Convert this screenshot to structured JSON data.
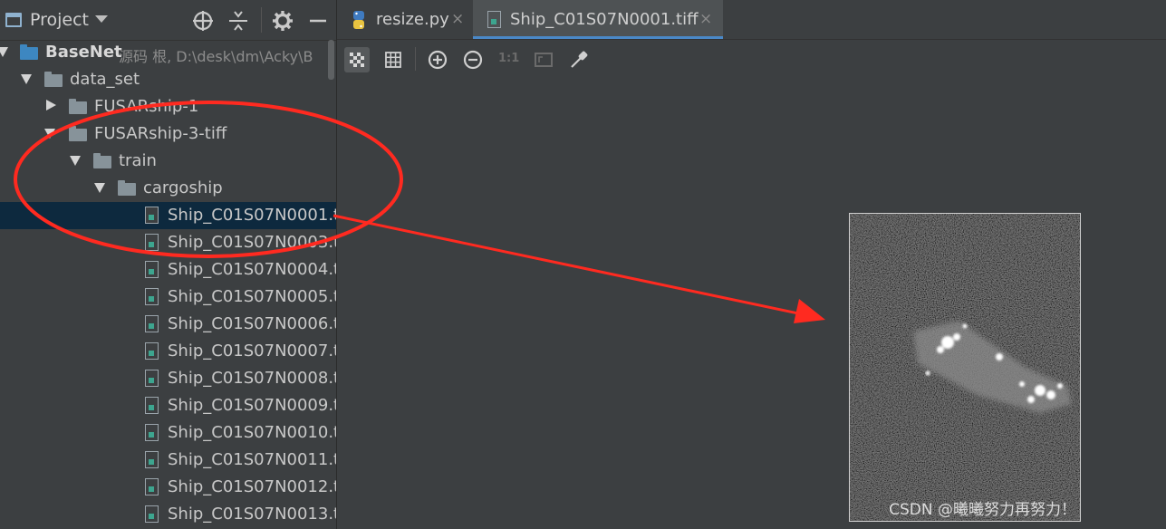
{
  "project": {
    "title": "Project",
    "icons": [
      "project-view-icon",
      "dropdown-caret-icon",
      "locate-target-icon",
      "collapse-all-icon",
      "gear-icon",
      "minimize-icon"
    ],
    "tree": [
      {
        "label": "BaseNet",
        "extra": "源码 根, D:\\desk\\dm\\Acky\\B",
        "type": "root-folder",
        "state": "expanded",
        "depth": 0
      },
      {
        "label": "data_set",
        "type": "folder",
        "state": "expanded",
        "depth": 1
      },
      {
        "label": "FUSARship-1",
        "type": "folder",
        "state": "collapsed",
        "depth": 2
      },
      {
        "label": "FUSARship-3-tiff",
        "type": "folder",
        "state": "expanded",
        "depth": 2
      },
      {
        "label": "train",
        "type": "folder",
        "state": "expanded",
        "depth": 3
      },
      {
        "label": "cargoship",
        "type": "folder",
        "state": "expanded",
        "depth": 4
      },
      {
        "label": "Ship_C01S07N0001.ti",
        "type": "file",
        "selected": true
      },
      {
        "label": "Ship_C01S07N0003.ti",
        "type": "file"
      },
      {
        "label": "Ship_C01S07N0004.ti",
        "type": "file"
      },
      {
        "label": "Ship_C01S07N0005.ti",
        "type": "file"
      },
      {
        "label": "Ship_C01S07N0006.ti",
        "type": "file"
      },
      {
        "label": "Ship_C01S07N0007.ti",
        "type": "file"
      },
      {
        "label": "Ship_C01S07N0008.ti",
        "type": "file"
      },
      {
        "label": "Ship_C01S07N0009.ti",
        "type": "file"
      },
      {
        "label": "Ship_C01S07N0010.ti",
        "type": "file"
      },
      {
        "label": "Ship_C01S07N0011.ti",
        "type": "file"
      },
      {
        "label": "Ship_C01S07N0012.ti",
        "type": "file"
      },
      {
        "label": "Ship_C01S07N0013.ti",
        "type": "file"
      }
    ]
  },
  "editor": {
    "tabs": [
      {
        "label": "resize.py",
        "icon": "python-file-icon",
        "active": false
      },
      {
        "label": "Ship_C01S07N0001.tiff",
        "icon": "image-file-icon",
        "active": true
      }
    ],
    "close_glyph": "×",
    "toolbar": {
      "tools": [
        "chessboard-background-icon",
        "grid-icon",
        "zoom-in-icon",
        "zoom-out-icon",
        "actual-size-icon",
        "fit-zoom-icon",
        "color-picker-icon"
      ],
      "actual_size_label": "1:1"
    },
    "watermark": "CSDN @曦曦努力再努力！"
  },
  "colors": {
    "background": "#3c3f41",
    "selection": "#0d293e",
    "active_tab_underline": "#4a88c7",
    "annotation": "#ff2a20"
  }
}
